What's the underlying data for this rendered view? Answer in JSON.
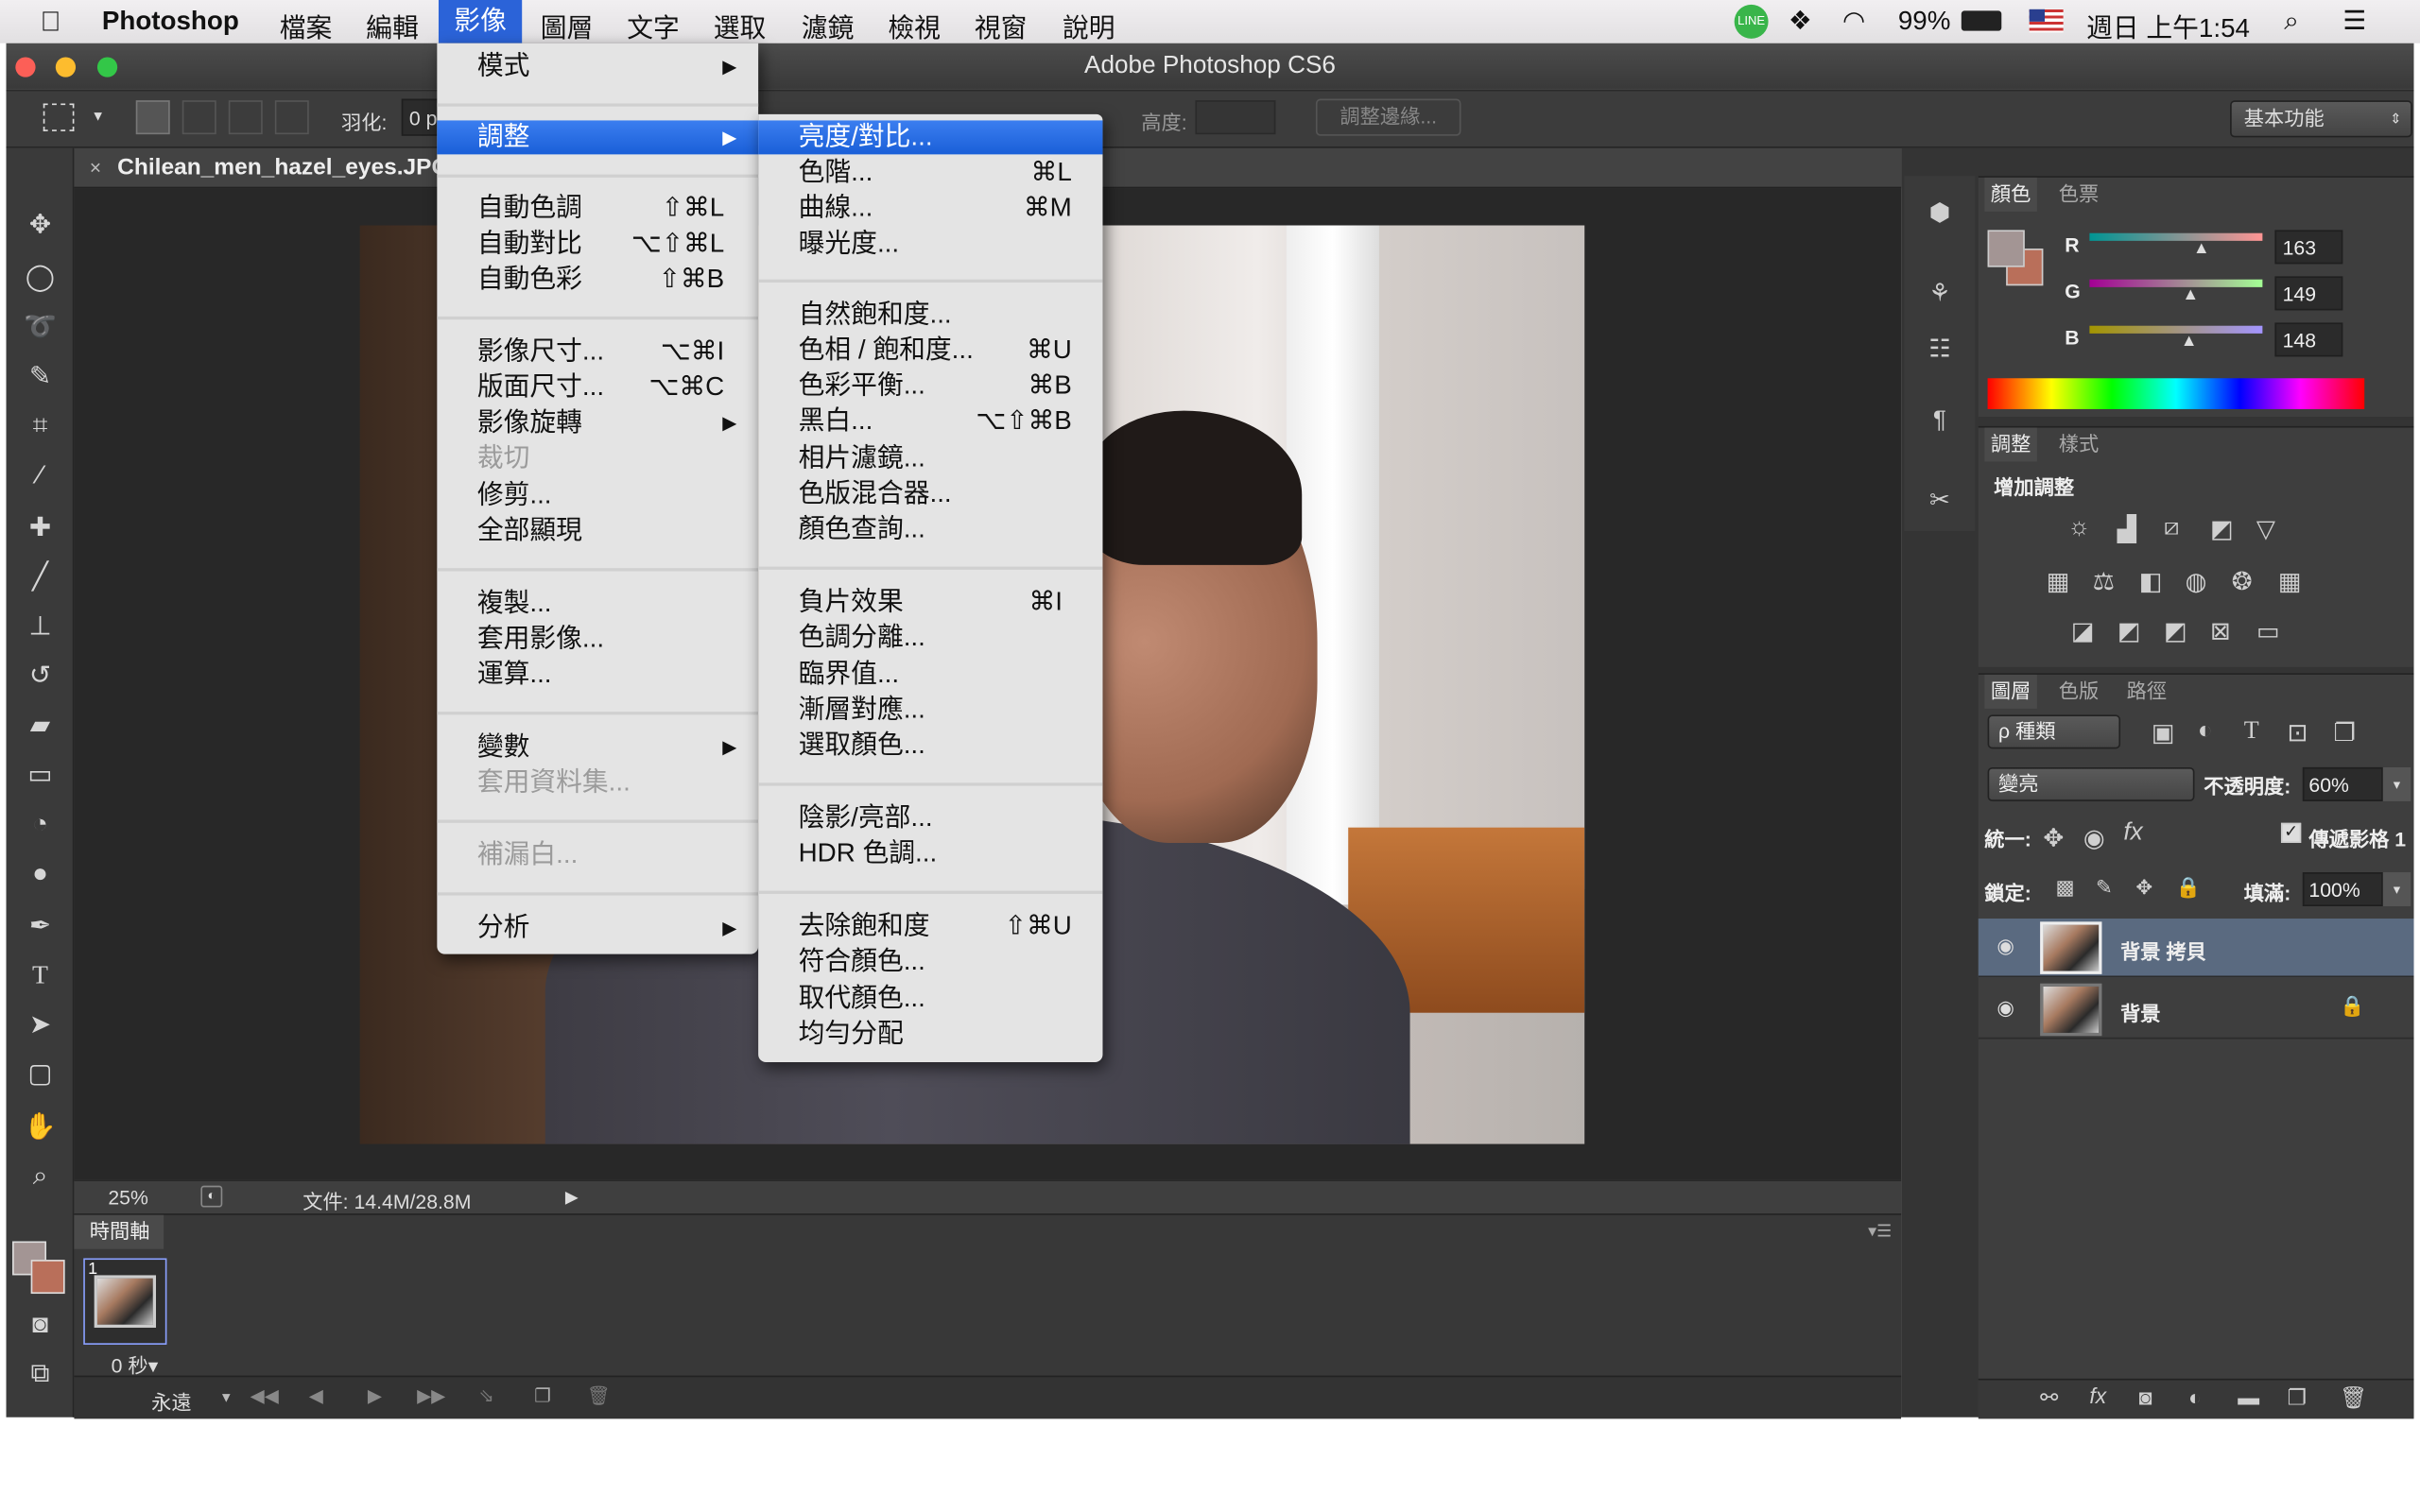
{
  "menubar": {
    "apple": "",
    "app": "Photoshop",
    "items": [
      "檔案",
      "編輯",
      "影像",
      "圖層",
      "文字",
      "選取",
      "濾鏡",
      "檢視",
      "視窗",
      "說明"
    ],
    "battery": "99%",
    "clock": "週日 上午1:54"
  },
  "window": {
    "title": "Adobe Photoshop CS6"
  },
  "options": {
    "feather_label": "羽化:",
    "feather_value": "0 p",
    "refine_edge": "調整邊緣...",
    "height_label": "高度:",
    "workspace": "基本功能"
  },
  "document": {
    "tab": "Chilean_men_hazel_eyes.JPG",
    "zoom": "25%",
    "file_info": "文件: 14.4M/28.8M"
  },
  "timeline": {
    "title": "時間軸",
    "frame_number": "1",
    "frame_delay": "0 秒▾",
    "loop": "永遠"
  },
  "image_menu": {
    "items": [
      {
        "label": "模式",
        "shortcut": "",
        "sub": true,
        "enabled": true
      },
      {
        "label": "調整",
        "shortcut": "",
        "sub": true,
        "enabled": true,
        "highlight": true
      },
      {
        "label": "自動色調",
        "shortcut": "⇧⌘L",
        "sub": false,
        "enabled": true
      },
      {
        "label": "自動對比",
        "shortcut": "⌥⇧⌘L",
        "sub": false,
        "enabled": true
      },
      {
        "label": "自動色彩",
        "shortcut": "⇧⌘B",
        "sub": false,
        "enabled": true
      },
      {
        "label": "影像尺寸...",
        "shortcut": "⌥⌘I",
        "sub": false,
        "enabled": true
      },
      {
        "label": "版面尺寸...",
        "shortcut": "⌥⌘C",
        "sub": false,
        "enabled": true
      },
      {
        "label": "影像旋轉",
        "shortcut": "",
        "sub": true,
        "enabled": true
      },
      {
        "label": "裁切",
        "shortcut": "",
        "sub": false,
        "enabled": false
      },
      {
        "label": "修剪...",
        "shortcut": "",
        "sub": false,
        "enabled": true
      },
      {
        "label": "全部顯現",
        "shortcut": "",
        "sub": false,
        "enabled": true
      },
      {
        "label": "複製...",
        "shortcut": "",
        "sub": false,
        "enabled": true
      },
      {
        "label": "套用影像...",
        "shortcut": "",
        "sub": false,
        "enabled": true
      },
      {
        "label": "運算...",
        "shortcut": "",
        "sub": false,
        "enabled": true
      },
      {
        "label": "變數",
        "shortcut": "",
        "sub": true,
        "enabled": true
      },
      {
        "label": "套用資料集...",
        "shortcut": "",
        "sub": false,
        "enabled": false
      },
      {
        "label": "補漏白...",
        "shortcut": "",
        "sub": false,
        "enabled": false
      },
      {
        "label": "分析",
        "shortcut": "",
        "sub": true,
        "enabled": true
      }
    ]
  },
  "adjust_menu": {
    "items": [
      {
        "label": "亮度/對比...",
        "shortcut": "",
        "highlight": true
      },
      {
        "label": "色階...",
        "shortcut": "⌘L"
      },
      {
        "label": "曲線...",
        "shortcut": "⌘M"
      },
      {
        "label": "曝光度...",
        "shortcut": ""
      },
      {
        "label": "自然飽和度...",
        "shortcut": ""
      },
      {
        "label": "色相 / 飽和度...",
        "shortcut": "⌘U"
      },
      {
        "label": "色彩平衡...",
        "shortcut": "⌘B"
      },
      {
        "label": "黑白...",
        "shortcut": "⌥⇧⌘B"
      },
      {
        "label": "相片濾鏡...",
        "shortcut": ""
      },
      {
        "label": "色版混合器...",
        "shortcut": ""
      },
      {
        "label": "顏色查詢...",
        "shortcut": ""
      },
      {
        "label": "負片效果",
        "shortcut": "⌘I"
      },
      {
        "label": "色調分離...",
        "shortcut": ""
      },
      {
        "label": "臨界值...",
        "shortcut": ""
      },
      {
        "label": "漸層對應...",
        "shortcut": ""
      },
      {
        "label": "選取顏色...",
        "shortcut": ""
      },
      {
        "label": "陰影/亮部...",
        "shortcut": ""
      },
      {
        "label": "HDR 色調...",
        "shortcut": ""
      },
      {
        "label": "去除飽和度",
        "shortcut": "⇧⌘U"
      },
      {
        "label": "符合顏色...",
        "shortcut": ""
      },
      {
        "label": "取代顏色...",
        "shortcut": ""
      },
      {
        "label": "均勻分配",
        "shortcut": ""
      }
    ]
  },
  "color_panel": {
    "tabs": [
      "顏色",
      "色票"
    ],
    "r_label": "R",
    "g_label": "G",
    "b_label": "B",
    "r": "163",
    "g": "149",
    "b": "148",
    "fg_color": "#a39594",
    "bg_color": "#b96f5a"
  },
  "adjust_panel": {
    "tabs": [
      "調整",
      "樣式"
    ],
    "heading": "增加調整"
  },
  "layers_panel": {
    "tabs": [
      "圖層",
      "色版",
      "路徑"
    ],
    "kind": "ρ 種類",
    "blend": "變亮",
    "opacity_label": "不透明度:",
    "opacity": "60%",
    "unify_label": "統一:",
    "propagate": "傳遞影格 1",
    "lock_label": "鎖定:",
    "fill_label": "填滿:",
    "fill": "100%",
    "layers": [
      {
        "name": "背景 拷貝",
        "selected": true
      },
      {
        "name": "背景",
        "selected": false
      }
    ]
  }
}
